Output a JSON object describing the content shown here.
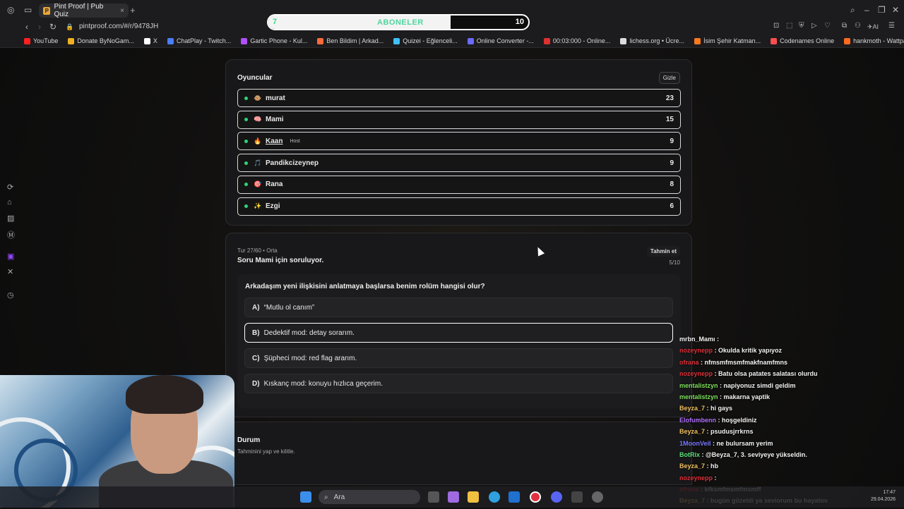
{
  "browser": {
    "tab_title": "Pint Proof | Pub Quiz",
    "tab_favicon_letter": "P",
    "url": "pintproof.com/#/r/9478JH",
    "bookmarks": [
      {
        "label": "YouTube",
        "color": "#ff2020"
      },
      {
        "label": "Donate ByNoGam...",
        "color": "#f0b020"
      },
      {
        "label": "X",
        "color": "#ffffff"
      },
      {
        "label": "ChatPlay - Twitch...",
        "color": "#4a7dff"
      },
      {
        "label": "Gartic Phone - Kul...",
        "color": "#b050ff"
      },
      {
        "label": "Ben Bildim | Arkad...",
        "color": "#ff6a3a"
      },
      {
        "label": "Quizei - Eğlenceli...",
        "color": "#40c0ff"
      },
      {
        "label": "Online Converter -...",
        "color": "#6a6aff"
      },
      {
        "label": "00:03:000 - Online...",
        "color": "#e03030"
      },
      {
        "label": "lichess.org • Ücre...",
        "color": "#dddddd"
      },
      {
        "label": "İsim Şehir Katman...",
        "color": "#ff7a20"
      },
      {
        "label": "Codenames Online",
        "color": "#ff5050"
      },
      {
        "label": "hankmoth - Wattpad",
        "color": "#ff6a20"
      }
    ]
  },
  "overlay": {
    "sub_current": "7",
    "sub_label": "ABONELER",
    "sub_goal": "10",
    "sub_progress": 0.7
  },
  "players_card": {
    "title": "Oyuncular",
    "hide_label": "Gizle",
    "players": [
      {
        "name": "murat",
        "score": "23",
        "emoji": "🐵",
        "host": ""
      },
      {
        "name": "Mami",
        "score": "15",
        "emoji": "🧠",
        "host": ""
      },
      {
        "name": "Kaan",
        "score": "9",
        "emoji": "🔥",
        "host": "Host"
      },
      {
        "name": "Pandikcizeynep",
        "score": "9",
        "emoji": "🎵",
        "host": ""
      },
      {
        "name": "Rana",
        "score": "8",
        "emoji": "🎯",
        "host": ""
      },
      {
        "name": "Ezgi",
        "score": "6",
        "emoji": "✨",
        "host": ""
      }
    ]
  },
  "question_card": {
    "round_meta": "Tur 27/60 • Orta",
    "subtitle": "Soru Mami için soruluyor.",
    "guess_label": "Tahmin et",
    "progress": "5/10",
    "question": "Arkadaşım yeni ilişkisini anlatmaya başlarsa benim rolüm hangisi olur?",
    "options": [
      {
        "letter": "A)",
        "text": "“Mutlu ol canım”",
        "selected": false
      },
      {
        "letter": "B)",
        "text": "Dedektif mod: detay sorarım.",
        "selected": true
      },
      {
        "letter": "C)",
        "text": "Şüpheci mod: red flag ararım.",
        "selected": false
      },
      {
        "letter": "D)",
        "text": "Kıskanç mod: konuyu hızlıca geçerim.",
        "selected": false
      }
    ]
  },
  "status_card": {
    "title": "Durum",
    "text": "Tahminini yap ve kilitle."
  },
  "chat": [
    {
      "user": "mrbn_Mamı",
      "color": "#f2f2f2",
      "msg": ""
    },
    {
      "user": "nozeynepp",
      "color": "#e0303a",
      "msg": "Okulda kritik yapıyoz"
    },
    {
      "user": "ofrana",
      "color": "#e0303a",
      "msg": "nfmsmfmsmfmakfnamfmns"
    },
    {
      "user": "nozeynepp",
      "color": "#e0303a",
      "msg": "Batu olsa patates salatası olurdu"
    },
    {
      "user": "mentalistzyn",
      "color": "#7ee05a",
      "msg": "napiyonuz simdi geldim"
    },
    {
      "user": "mentalistzyn",
      "color": "#7ee05a",
      "msg": "makarna yaptik"
    },
    {
      "user": "Beyza_7",
      "color": "#f0c060",
      "msg": "hi gays"
    },
    {
      "user": "Elofumbenn",
      "color": "#b070ff",
      "msg": "hoşgeldiniz"
    },
    {
      "user": "Beyza_7",
      "color": "#f0c060",
      "msg": "psudusjrrkrns"
    },
    {
      "user": "1MoonVeil",
      "color": "#7a7aff",
      "msg": "ne bulursam yerim"
    },
    {
      "user": "BotRix",
      "color": "#5ee07a",
      "msg": "@Beyza_7, 3. seviyeye yükseldin."
    },
    {
      "user": "Beyza_7",
      "color": "#f0c060",
      "msg": "hb"
    },
    {
      "user": "nozeynepp",
      "color": "#e0303a",
      "msg": ""
    },
    {
      "user": "ofrana",
      "color": "#e0303a",
      "msg": "kfksmfmsmfmsmff"
    },
    {
      "user": "Beyza_7",
      "color": "#f0c060",
      "msg": "bugün güzeldi ya seviorum bu hayatını"
    }
  ],
  "taskbar": {
    "search_placeholder": "Ara",
    "clock_time": "17:47",
    "clock_date": "29.04.2026"
  }
}
